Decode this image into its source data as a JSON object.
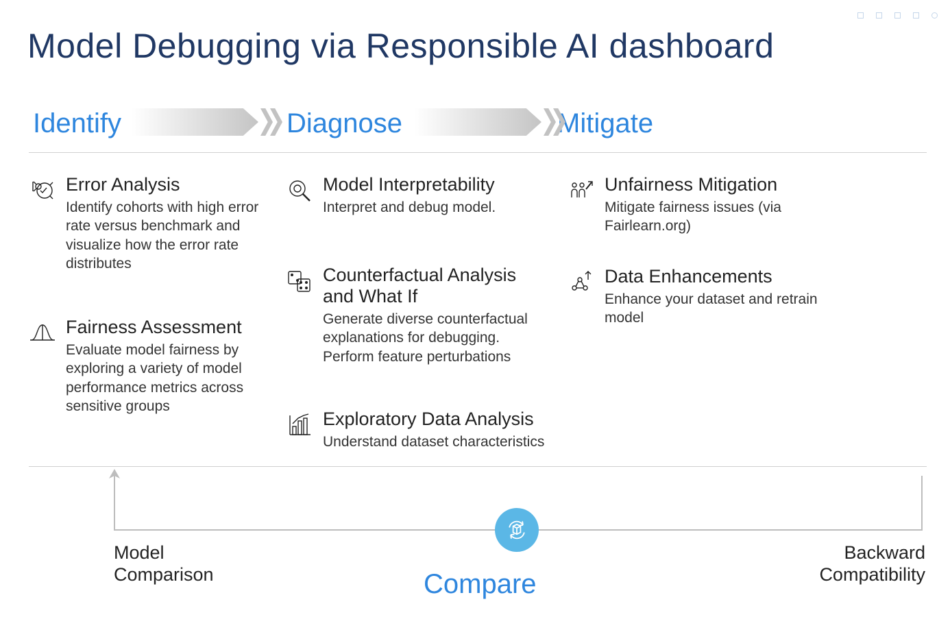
{
  "title": "Model Debugging via Responsible AI dashboard",
  "stages": {
    "identify": "Identify",
    "diagnose": "Diagnose",
    "mitigate": "Mitigate"
  },
  "items": {
    "error_analysis": {
      "title": "Error Analysis",
      "desc": "Identify cohorts with high error rate versus benchmark and visualize how the error rate distributes"
    },
    "fairness": {
      "title": "Fairness Assessment",
      "desc": "Evaluate model fairness by exploring a variety of model performance metrics across sensitive groups"
    },
    "interp": {
      "title": "Model Interpretability",
      "desc": "Interpret and debug model."
    },
    "counterfactual": {
      "title": "Counterfactual Analysis and What If",
      "desc": "Generate diverse counterfactual explanations for debugging. Perform feature perturbations"
    },
    "eda": {
      "title": "Exploratory Data Analysis",
      "desc": "Understand dataset characteristics"
    },
    "unfair": {
      "title": "Unfairness Mitigation",
      "desc": "Mitigate fairness issues (via Fairlearn.org)"
    },
    "data_enh": {
      "title": "Data Enhancements",
      "desc": "Enhance your dataset and retrain model"
    }
  },
  "compare": {
    "label": "Compare",
    "left": "Model\nComparison",
    "right": "Backward\nCompatibility"
  }
}
